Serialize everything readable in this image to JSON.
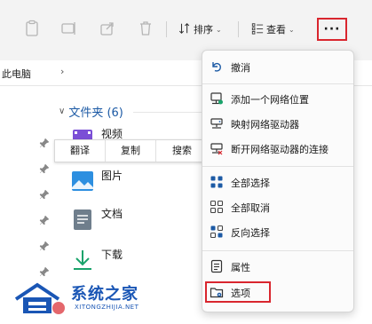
{
  "toolbar": {
    "sort_label": "排序",
    "view_label": "查看",
    "more_label": "···"
  },
  "address": {
    "path": "此电脑",
    "chevron": "›"
  },
  "group": {
    "chevron": "∨",
    "title": "文件夹 (6)"
  },
  "items": [
    {
      "label": "视频"
    },
    {
      "label": "图片"
    },
    {
      "label": "文档"
    },
    {
      "label": "下载"
    }
  ],
  "context_bar": {
    "items": [
      "翻译",
      "复制",
      "搜索"
    ]
  },
  "menu": {
    "items": [
      {
        "label": "撤消",
        "icon": "undo-icon"
      },
      {
        "label": "添加一个网络位置",
        "icon": "network-location-icon"
      },
      {
        "label": "映射网络驱动器",
        "icon": "map-drive-icon"
      },
      {
        "label": "断开网络驱动器的连接",
        "icon": "disconnect-drive-icon"
      },
      {
        "label": "全部选择",
        "icon": "select-all-icon"
      },
      {
        "label": "全部取消",
        "icon": "select-none-icon"
      },
      {
        "label": "反向选择",
        "icon": "invert-selection-icon"
      },
      {
        "label": "属性",
        "icon": "properties-icon"
      },
      {
        "label": "选项",
        "icon": "options-icon"
      }
    ]
  },
  "watermark": {
    "title": "系统之家",
    "subtitle": "XITONGZHIJIA.NET"
  },
  "colors": {
    "highlight": "#d9262e",
    "accent": "#1c5aa5"
  }
}
